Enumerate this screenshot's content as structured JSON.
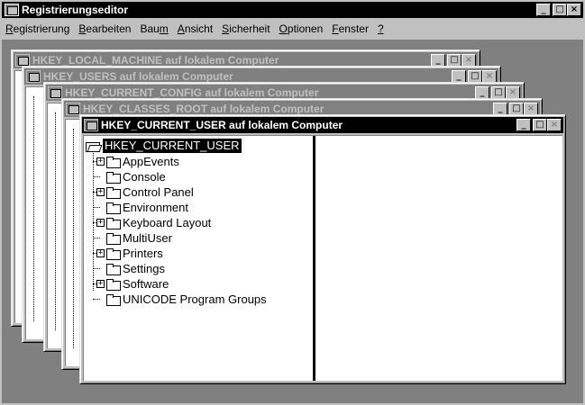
{
  "app": {
    "title": "Registrierungseditor",
    "title_buttons": [
      "_",
      "□",
      "×"
    ]
  },
  "menu": [
    {
      "accel": "R",
      "rest": "egistrierung"
    },
    {
      "accel": "B",
      "rest": "earbeiten"
    },
    {
      "pre": "Bau",
      "accel": "m",
      "rest": ""
    },
    {
      "accel": "A",
      "rest": "nsicht"
    },
    {
      "accel": "S",
      "rest": "icherheit"
    },
    {
      "accel": "O",
      "rest": "ptionen"
    },
    {
      "accel": "F",
      "rest": "enster"
    },
    {
      "accel": "?",
      "rest": ""
    }
  ],
  "windows": [
    {
      "title": "HKEY_LOCAL_MACHINE auf lokalem Computer"
    },
    {
      "title": "HKEY_USERS auf lokalem Computer"
    },
    {
      "title": "HKEY_CURRENT_CONFIG auf lokalem Computer"
    },
    {
      "title": "HKEY_CLASSES_ROOT auf lokalem Computer"
    },
    {
      "title": "HKEY_CURRENT_USER auf lokalem Computer"
    }
  ],
  "child_buttons": [
    "_",
    "□",
    "×"
  ],
  "scroll_left_arrow": "◄",
  "tree": {
    "root": "HKEY_CURRENT_USER",
    "items": [
      {
        "label": "AppEvents",
        "expandable": true
      },
      {
        "label": "Console",
        "expandable": false
      },
      {
        "label": "Control Panel",
        "expandable": true
      },
      {
        "label": "Environment",
        "expandable": false
      },
      {
        "label": "Keyboard Layout",
        "expandable": true
      },
      {
        "label": "MultiUser",
        "expandable": false
      },
      {
        "label": "Printers",
        "expandable": true
      },
      {
        "label": "Settings",
        "expandable": false
      },
      {
        "label": "Software",
        "expandable": true
      },
      {
        "label": "UNICODE Program Groups",
        "expandable": false
      }
    ],
    "expander_symbol": "+"
  }
}
